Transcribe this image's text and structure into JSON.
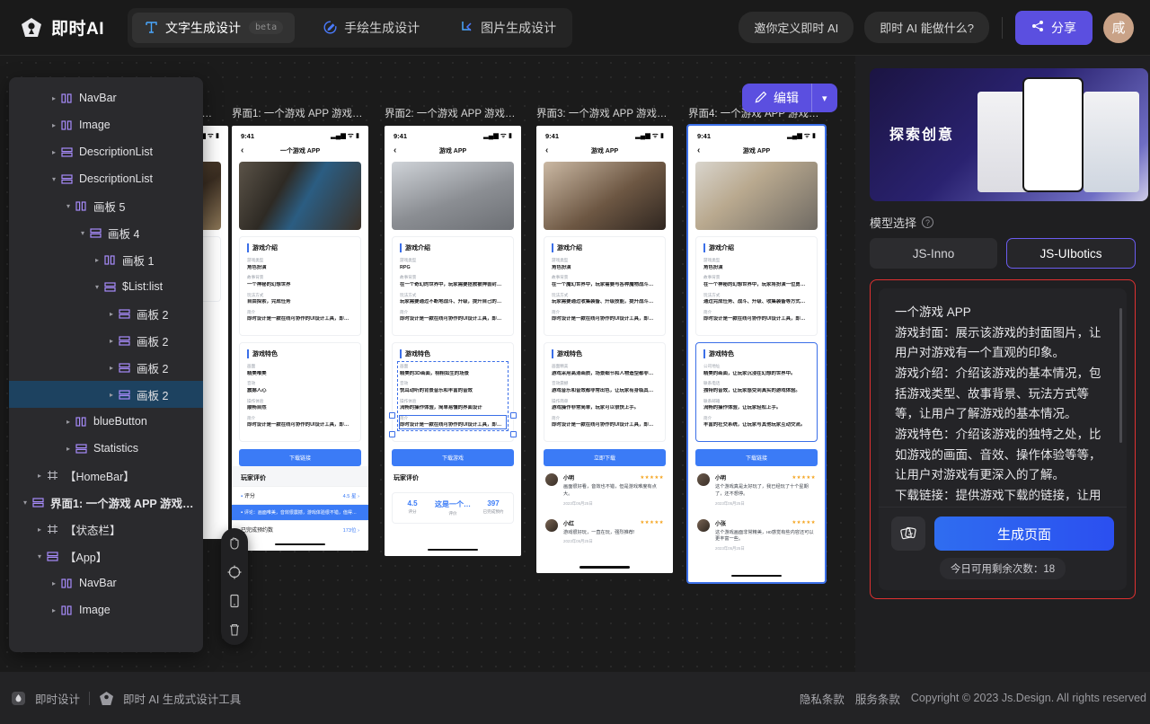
{
  "header": {
    "brand": "即时AI",
    "brand_logo_icon": "diamond-logo-icon",
    "tabs": [
      {
        "label": "文字生成设计",
        "icon": "text-tool-icon",
        "badge": "beta",
        "active": true
      },
      {
        "label": "手绘生成设计",
        "icon": "pen-sketch-icon",
        "badge": "",
        "active": false
      },
      {
        "label": "图片生成设计",
        "icon": "image-tool-icon",
        "badge": "",
        "active": false
      }
    ],
    "pill_invite": "邀你定义即时 AI",
    "pill_help": "即时 AI 能做什么?",
    "share_label": "分享",
    "share_icon": "share-icon",
    "share_color": "#5b4fe0",
    "avatar_initial": "咸",
    "avatar_color": "#c9a287"
  },
  "canvas": {
    "edit_label": "编辑",
    "edit_icon": "pencil-icon",
    "edit_caret_icon": "chevron-down-icon",
    "tools": [
      {
        "name": "hand-tool",
        "icon": "hand-icon"
      },
      {
        "name": "target-tool",
        "icon": "target-icon"
      },
      {
        "name": "device-tool",
        "icon": "phone-icon"
      },
      {
        "name": "delete-tool",
        "icon": "trash-icon"
      }
    ],
    "boards": [
      {
        "title": "界面1: 一个游戏 APP 游戏封...",
        "time": "9:41",
        "nav_title": "一个游戏 APP",
        "selected": false,
        "intro_heading": "游戏介绍",
        "intro_fields": [
          {
            "k": "游戏类型",
            "v": "角色扮演"
          },
          {
            "k": "故事背景",
            "v": "一个神秘的幻想世界"
          },
          {
            "k": "玩法方式",
            "v": "自由探索，完成任务"
          },
          {
            "k": "简介",
            "v": "即时设计是一款在线可协作的UI设计工具，即时…"
          }
        ],
        "feature_heading": "游戏特色",
        "feature_fields": [
          {
            "k": "画面",
            "v": "精美唯美"
          },
          {
            "k": "音效",
            "v": "震撼人心"
          },
          {
            "k": "操作体验",
            "v": "顺畅自然"
          },
          {
            "k": "简介",
            "v": "即时设计是一款在线可协作的UI设计工具，即时…"
          }
        ],
        "download_label": "下载链接",
        "review_heading": "玩家评价",
        "review_style": "rows",
        "rows": [
          {
            "label": "评分",
            "value": "4.5 星",
            "highlight": false
          },
          {
            "label": "评论：画面唯美，音效很震撼，游戏体验很不错，值得…",
            "value": "",
            "highlight": true
          },
          {
            "label": "已完成预约数",
            "value": "173位",
            "highlight": false
          }
        ]
      },
      {
        "title": "界面2: 一个游戏 APP 游戏封...",
        "time": "9:41",
        "nav_title": "游戏 APP",
        "selected": false,
        "intro_heading": "游戏介绍",
        "intro_fields": [
          {
            "k": "游戏类型",
            "v": "RPG"
          },
          {
            "k": "故事背景",
            "v": "在一个奇幻的世界中，玩家需要拯救被神兽封印…"
          },
          {
            "k": "玩法方式",
            "v": "玩家需要通过不断地战斗、升级，提升自己的…"
          },
          {
            "k": "简介",
            "v": "即时设计是一款在线可协作的UI设计工具，即时…"
          }
        ],
        "feature_heading": "游戏特色",
        "feature_fields": [
          {
            "k": "画面",
            "v": "精美的3D画面，栩栩如生的场景"
          },
          {
            "k": "音效",
            "v": "悦耳动听的背景音乐和丰富的音效"
          },
          {
            "k": "操作体验",
            "v": "流畅的操作体验，简单易懂的界面设计"
          },
          {
            "k": "简介",
            "v": "即时设计是一款在线可协作的UI设计工具，即时…"
          }
        ],
        "download_label": "下载游戏",
        "review_heading": "玩家评价",
        "review_style": "stats",
        "stats": [
          {
            "n": "4.5",
            "c": "评分"
          },
          {
            "n": "这是一个…",
            "c": "评价"
          },
          {
            "n": "397",
            "c": "已完成预约"
          }
        ]
      },
      {
        "title": "界面3: 一个游戏 APP 游戏封...",
        "time": "9:41",
        "nav_title": "游戏 APP",
        "selected": false,
        "intro_heading": "游戏介绍",
        "intro_fields": [
          {
            "k": "游戏类型",
            "v": "角色扮演"
          },
          {
            "k": "故事背景",
            "v": "在一个魔幻世界中，玩家需要与各种魔物战斗。…"
          },
          {
            "k": "玩法方式",
            "v": "玩家需要通过收集装备、升级技能，提升战斗力…"
          },
          {
            "k": "简介",
            "v": "即时设计是一款在线可协作的UI设计工具，即时…"
          }
        ],
        "feature_heading": "游戏特色",
        "feature_fields": [
          {
            "k": "画面精美",
            "v": "游戏采用高清画质，场景细节和人物造型都非常…"
          },
          {
            "k": "音效震撼",
            "v": "游戏音乐和音效都非常出色，让玩家有身临其境…"
          },
          {
            "k": "操作简单",
            "v": "游戏操作非常简单，玩家可以很快上手。"
          },
          {
            "k": "简介",
            "v": "即时设计是一款在线可协作的UI设计工具，即时…"
          }
        ],
        "download_label": "立即下载",
        "review_heading": "",
        "review_style": "comments",
        "comments": [
          {
            "name": "小明",
            "stars": "★★★★★",
            "text": "画面很好看，音效也不错，但是游戏难度有点大。",
            "date": "2023年05月25日"
          },
          {
            "name": "小红",
            "stars": "★★★★★",
            "text": "游戏很好玩，一直在玩，强烈推荐!",
            "date": "2023年05月25日"
          }
        ]
      },
      {
        "title": "界面4: 一个游戏 APP 游戏封...",
        "time": "9:41",
        "nav_title": "游戏 APP",
        "selected": true,
        "intro_heading": "游戏介绍",
        "intro_fields": [
          {
            "k": "游戏类型",
            "v": "角色扮演"
          },
          {
            "k": "故事背景",
            "v": "在一个神秘的幻想世界中，玩家将扮演一位勇者…"
          },
          {
            "k": "玩法方式",
            "v": "通过完成任务、战斗、升级、收集装备等方式，…"
          },
          {
            "k": "简介",
            "v": "即时设计是一款在线可协作的UI设计工具，即时…"
          }
        ],
        "feature_heading": "游戏特色",
        "feature_fields": [
          {
            "k": "公司地址",
            "v": "精美的画面，让玩家沉浸在幻想的世界中。"
          },
          {
            "k": "联系电话",
            "v": "独特的音效，让玩家感受到真实的游戏体验。"
          },
          {
            "k": "联系邮箱",
            "v": "流畅的操作体验，让玩家轻松上手。"
          },
          {
            "k": "简介",
            "v": "丰富的社交系统，让玩家与其他玩家互动交流。"
          }
        ],
        "download_label": "下载链接",
        "review_heading": "",
        "review_style": "comments",
        "comments": [
          {
            "name": "小明",
            "stars": "★★★★★",
            "text": "这个游戏真是太好玩了，我已经玩了十个星期了，还不想停。",
            "date": "2023年05月25日"
          },
          {
            "name": "小张",
            "stars": "★★★★★",
            "text": "这个游戏画面非常精美，но感觉有些内容还可以更丰富一些。",
            "date": "2023年05月25日"
          }
        ]
      }
    ]
  },
  "tree": {
    "nodes": [
      {
        "label": "NavBar",
        "depth": 2,
        "icon": "component-icon",
        "twisty": "collapsed",
        "selected": false
      },
      {
        "label": "Image",
        "depth": 2,
        "icon": "component-icon",
        "twisty": "collapsed",
        "selected": false
      },
      {
        "label": "DescriptionList",
        "depth": 2,
        "icon": "frame-icon",
        "twisty": "collapsed",
        "selected": false
      },
      {
        "label": "DescriptionList",
        "depth": 2,
        "icon": "frame-icon",
        "twisty": "expanded",
        "selected": false
      },
      {
        "label": "画板 5",
        "depth": 3,
        "icon": "component-icon",
        "twisty": "expanded",
        "selected": false
      },
      {
        "label": "画板 4",
        "depth": 4,
        "icon": "frame-icon",
        "twisty": "expanded",
        "selected": false
      },
      {
        "label": "画板 1",
        "depth": 5,
        "icon": "component-icon",
        "twisty": "collapsed",
        "selected": false
      },
      {
        "label": "$List:list",
        "depth": 5,
        "icon": "frame-icon",
        "twisty": "expanded",
        "selected": false
      },
      {
        "label": "画板 2",
        "depth": 6,
        "icon": "frame-icon",
        "twisty": "collapsed",
        "selected": false
      },
      {
        "label": "画板 2",
        "depth": 6,
        "icon": "frame-icon",
        "twisty": "collapsed",
        "selected": false
      },
      {
        "label": "画板 2",
        "depth": 6,
        "icon": "frame-icon",
        "twisty": "collapsed",
        "selected": false
      },
      {
        "label": "画板 2",
        "depth": 6,
        "icon": "frame-icon",
        "twisty": "collapsed",
        "selected": true
      },
      {
        "label": "blueButton",
        "depth": 3,
        "icon": "component-icon",
        "twisty": "collapsed",
        "selected": false
      },
      {
        "label": "Statistics",
        "depth": 3,
        "icon": "frame-icon",
        "twisty": "collapsed",
        "selected": false
      },
      {
        "label": "【HomeBar】",
        "depth": 2,
        "icon": "board-icon",
        "twisty": "collapsed",
        "selected": false
      },
      {
        "label": "界面1: 一个游戏 APP 游戏封...",
        "depth": 1,
        "icon": "frame-icon",
        "twisty": "expanded",
        "selected": false,
        "bold": true
      },
      {
        "label": "【状态栏】",
        "depth": 2,
        "icon": "board-icon",
        "twisty": "collapsed",
        "selected": false
      },
      {
        "label": "【App】",
        "depth": 2,
        "icon": "frame-icon",
        "twisty": "expanded",
        "selected": false
      },
      {
        "label": "NavBar",
        "depth": 3,
        "icon": "component-icon",
        "twisty": "collapsed",
        "selected": false
      },
      {
        "label": "Image",
        "depth": 3,
        "icon": "component-icon",
        "twisty": "collapsed",
        "selected": false
      }
    ]
  },
  "right_panel": {
    "preview_text": "探索创意",
    "model_label": "模型选择",
    "help_icon": "question-icon",
    "models": [
      {
        "label": "JS-Inno",
        "active": false
      },
      {
        "label": "JS-UIbotics",
        "active": true
      }
    ],
    "accent": "#6b5cf0",
    "highlight_border": "#e03131",
    "prompt_text": "一个游戏 APP\n游戏封面：展示该游戏的封面图片，让用户对游戏有一个直观的印象。\n游戏介绍：介绍该游戏的基本情况，包括游戏类型、故事背景、玩法方式等等，让用户了解游戏的基本情况。\n游戏特色：介绍该游戏的独特之处，比如游戏的画面、音效、操作体验等等，让用户对游戏有更深入的了解。\n下载链接：提供游戏下载的链接，让用户可以方便地下载游戏。\n玩家评价：展示其他玩家对该游戏的评价，包括评分和评论，让用户了解游戏",
    "dice_icon": "dice-icon",
    "generate_label": "生成页面",
    "quota_text": "今日可用剩余次数：18"
  },
  "footer": {
    "left_brand": "即时设计",
    "left_logo_icon": "flame-logo-icon",
    "product_logo_icon": "diamond-logo-icon",
    "product_name": "即时 AI 生成式设计工具",
    "links": [
      "隐私条款",
      "服务条款"
    ],
    "copyright": "Copyright © 2023 Js.Design. All rights reserved"
  }
}
